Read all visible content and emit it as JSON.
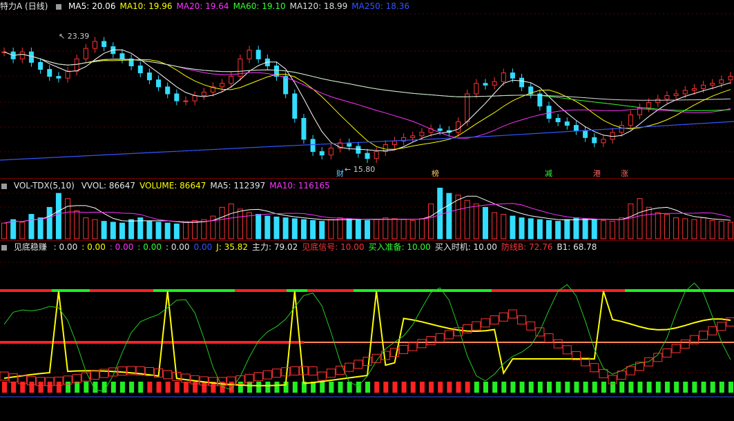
{
  "window": {
    "title": "特力A (日线)"
  },
  "main": {
    "ma": [
      {
        "label": "MA5: 20.06",
        "color": "#ffffff"
      },
      {
        "label": "MA10: 19.96",
        "color": "#ffff00"
      },
      {
        "label": "MA20: 19.64",
        "color": "#ff33ff"
      },
      {
        "label": "MA60: 19.10",
        "color": "#33ff33"
      },
      {
        "label": "MA120: 18.99",
        "color": "#dddddd"
      },
      {
        "label": "MA250: 18.36",
        "color": "#3355ff"
      }
    ],
    "high_label": "23.39",
    "low_label": "15.80",
    "tags": [
      {
        "text": "财",
        "color": "#66ccff"
      },
      {
        "text": "榜",
        "color": "#ffcc66"
      },
      {
        "text": "减",
        "color": "#33ff33"
      },
      {
        "text": "港",
        "color": "#ff6666"
      },
      {
        "text": "涨",
        "color": "#ff6666"
      }
    ]
  },
  "vol": {
    "title": "VOL-TDX(5,10)",
    "labels": [
      {
        "label": "VVOL: 86647",
        "color": "#e6e6e6"
      },
      {
        "label": "VOLUME: 86647",
        "color": "#ffff00"
      },
      {
        "label": "MA5: 112397",
        "color": "#e6e6e6"
      },
      {
        "label": "MA10: 116165",
        "color": "#ff33ff"
      }
    ]
  },
  "ind": {
    "title": "见底稳赚",
    "labels": [
      {
        "label": ": 0.00",
        "color": "#e6e6e6"
      },
      {
        "label": ": 0.00",
        "color": "#ffff00"
      },
      {
        "label": ": 0.00",
        "color": "#ff33ff"
      },
      {
        "label": ": 0.00",
        "color": "#33ff33"
      },
      {
        "label": ": 0.00",
        "color": "#e6e6e6"
      },
      {
        "label": "0.00",
        "color": "#3355ff"
      },
      {
        "label": "J: 35.82",
        "color": "#ffff00"
      },
      {
        "label": "主力: 79.02",
        "color": "#e6e6e6"
      },
      {
        "label": "见底信号: 10.00",
        "color": "#ff3333"
      },
      {
        "label": "买入准备: 10.00",
        "color": "#33ff33"
      },
      {
        "label": "买入时机: 10.00",
        "color": "#e6e6e6"
      },
      {
        "label": "防线B: 72.76",
        "color": "#ff3333"
      },
      {
        "label": "B1: 68.78",
        "color": "#e6e6e6"
      }
    ]
  },
  "chart_data": {
    "type": "line",
    "price_axis_estimated": [
      15.5,
      24.5
    ],
    "close_series_estimated": [
      22.4,
      22.0,
      22.4,
      21.8,
      21.4,
      21.0,
      20.9,
      21.3,
      22.0,
      22.6,
      23.0,
      22.7,
      22.3,
      22.0,
      21.6,
      21.2,
      20.8,
      20.4,
      20.0,
      19.6,
      19.6,
      19.9,
      20.1,
      20.4,
      20.6,
      21.0,
      22.0,
      22.5,
      22.0,
      21.6,
      21.0,
      20.0,
      18.6,
      17.4,
      16.7,
      16.5,
      16.9,
      17.2,
      17.0,
      16.6,
      16.3,
      16.7,
      17.1,
      17.3,
      17.5,
      17.6,
      17.8,
      18.0,
      17.9,
      17.8,
      18.4,
      20.0,
      20.6,
      20.5,
      20.7,
      21.2,
      20.9,
      20.4,
      20.0,
      19.3,
      18.6,
      18.4,
      18.2,
      17.9,
      17.5,
      17.2,
      17.4,
      17.8,
      18.2,
      18.8,
      19.2,
      19.5,
      19.7,
      19.9,
      20.0,
      20.2,
      20.3,
      20.5,
      20.6,
      20.8,
      21.0
    ],
    "volume_series_estimated": [
      90,
      110,
      95,
      140,
      120,
      180,
      260,
      230,
      160,
      120,
      110,
      100,
      95,
      90,
      110,
      120,
      100,
      95,
      90,
      85,
      95,
      105,
      110,
      130,
      180,
      200,
      170,
      150,
      140,
      130,
      125,
      120,
      115,
      110,
      105,
      100,
      110,
      120,
      115,
      110,
      105,
      110,
      120,
      115,
      110,
      105,
      115,
      200,
      290,
      260,
      250,
      220,
      200,
      180,
      150,
      140,
      130,
      120,
      115,
      110,
      105,
      100,
      110,
      120,
      115,
      110,
      105,
      100,
      120,
      200,
      230,
      180,
      150,
      140,
      120,
      115,
      110,
      120,
      105,
      100,
      95
    ],
    "volume_unit": "thousand shares (estimated)"
  }
}
